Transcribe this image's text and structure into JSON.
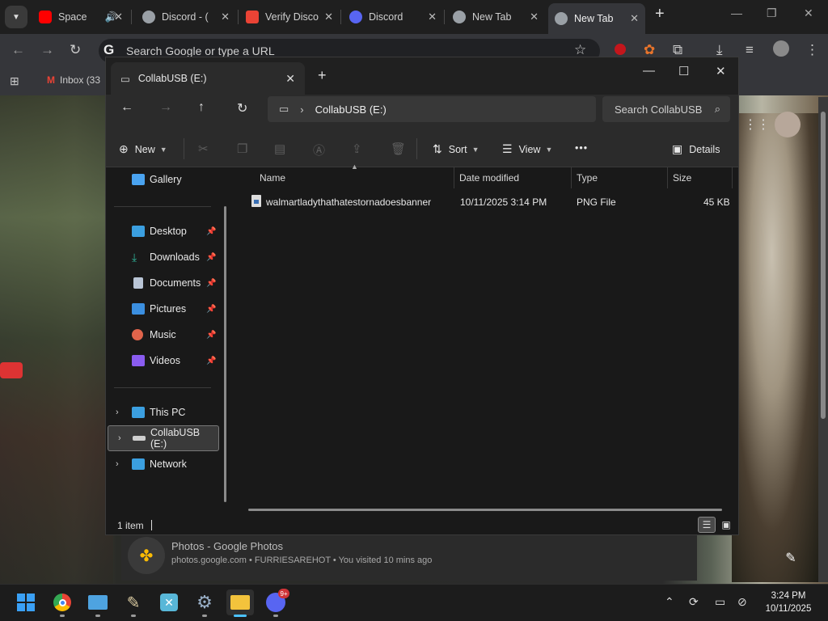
{
  "browser": {
    "tabs": [
      {
        "label": "Space",
        "favicon_color": "#ff0000",
        "icon": "youtube-icon",
        "audio": true
      },
      {
        "label": "Discord - (",
        "favicon_color": "#9aa0a6",
        "icon": "globe-icon"
      },
      {
        "label": "Verify Disco",
        "favicon_color": "#ea4335",
        "icon": "gmail-icon"
      },
      {
        "label": "Discord",
        "favicon_color": "#5865f2",
        "icon": "discord-icon"
      },
      {
        "label": "New Tab",
        "favicon_color": "#9aa0a6",
        "icon": "chrome-icon"
      },
      {
        "label": "New Tab",
        "favicon_color": "#9aa0a6",
        "icon": "chrome-icon",
        "active": true
      }
    ],
    "new_tab_symbol": "+",
    "omnibox_placeholder": "Search Google or type a URL",
    "bookmarks": [
      {
        "label": "Inbox (33"
      }
    ],
    "suggestion": {
      "title": "Photos - Google Photos",
      "subtitle": "photos.google.com • FURRIESAREHOT • You visited 10 mins ago"
    }
  },
  "explorer": {
    "tab_title": "CollabUSB (E:)",
    "address_segment": "CollabUSB (E:)",
    "search_placeholder": "Search CollabUSB",
    "commands": {
      "new": "New",
      "sort": "Sort",
      "view": "View",
      "more": "•••",
      "details": "Details"
    },
    "sidebar": {
      "top": [
        {
          "label": "Gallery",
          "icon": "gallery-icon",
          "color": "#4aa3f0"
        }
      ],
      "quick_access": [
        {
          "label": "Desktop",
          "icon": "desktop-icon",
          "color": "#3b9fe0"
        },
        {
          "label": "Downloads",
          "icon": "downloads-icon",
          "color": "#2fb59a"
        },
        {
          "label": "Documents",
          "icon": "documents-icon",
          "color": "#b9c5d6"
        },
        {
          "label": "Pictures",
          "icon": "pictures-icon",
          "color": "#3b8fe0"
        },
        {
          "label": "Music",
          "icon": "music-icon",
          "color": "#e0644b"
        },
        {
          "label": "Videos",
          "icon": "videos-icon",
          "color": "#8a5cf0"
        }
      ],
      "locations": [
        {
          "label": "This PC",
          "icon": "pc-icon",
          "color": "#3b9fe0"
        },
        {
          "label": "CollabUSB (E:)",
          "icon": "usb-drive-icon",
          "color": "#cfcfcf",
          "selected": true
        },
        {
          "label": "Network",
          "icon": "network-icon",
          "color": "#3b9fe0"
        }
      ]
    },
    "columns": {
      "name": "Name",
      "date": "Date modified",
      "type": "Type",
      "size": "Size"
    },
    "files": [
      {
        "name": "walmartladythathatestornadoesbanner",
        "date": "10/11/2025 3:14 PM",
        "type": "PNG File",
        "size": "45 KB"
      }
    ],
    "status": "1 item"
  },
  "taskbar": {
    "badge": "9+",
    "time": "3:24 PM",
    "date": "10/11/2025"
  }
}
